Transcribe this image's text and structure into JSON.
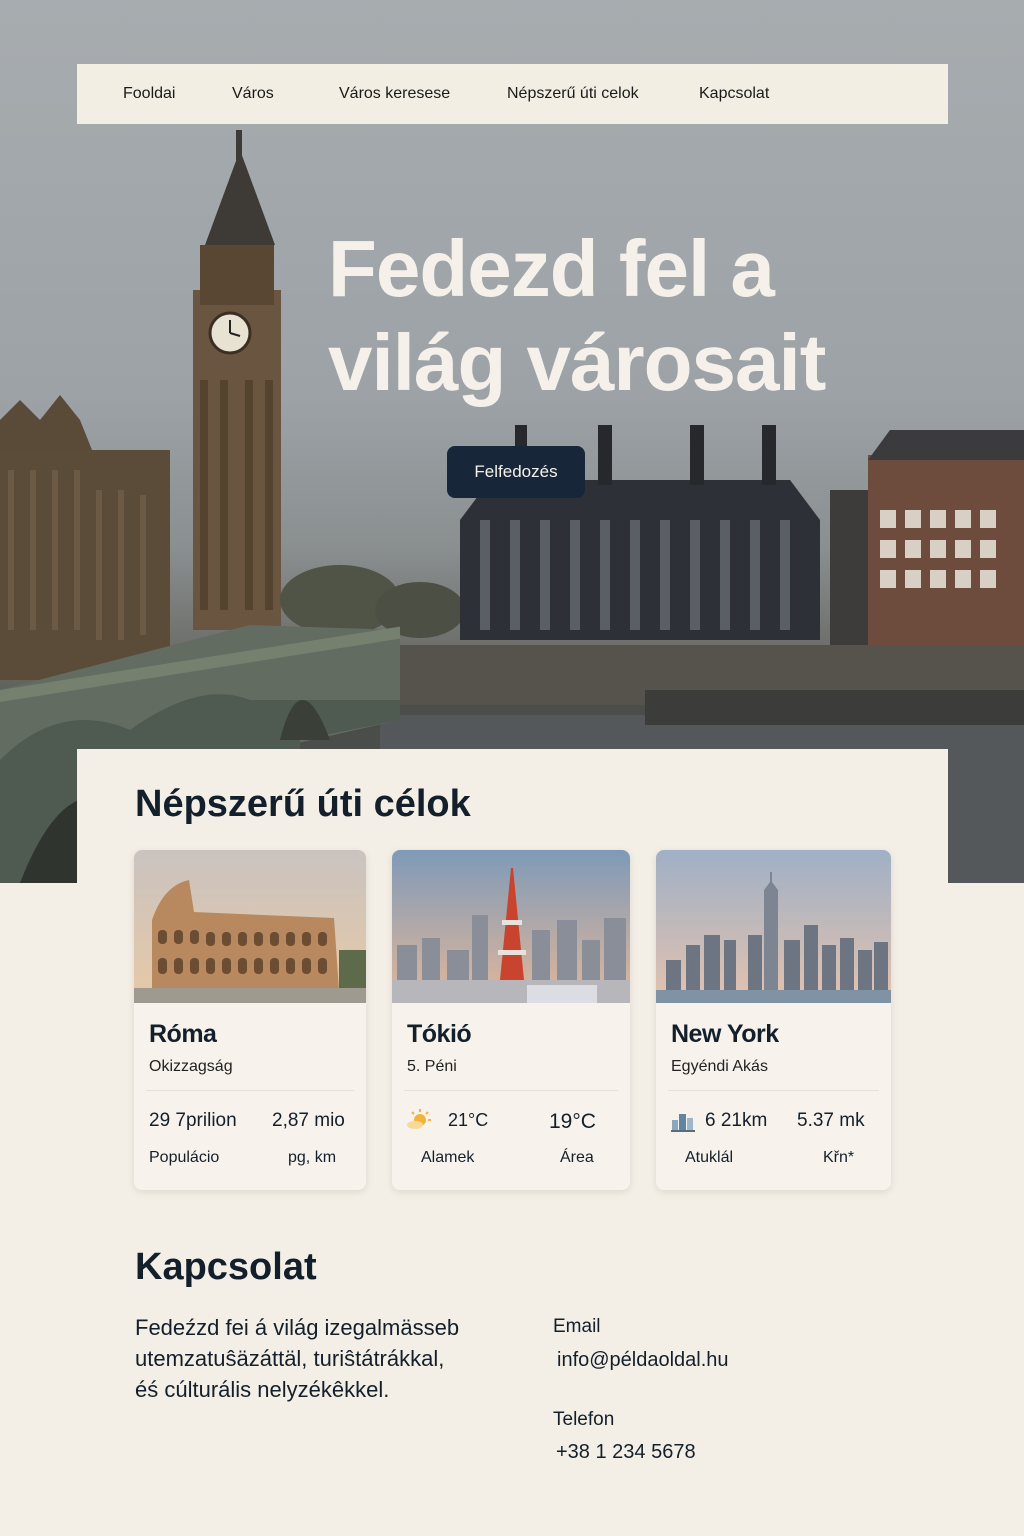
{
  "nav": {
    "items": [
      "Fooldai",
      "Város",
      "Város keresese",
      "Népszerű úti celok",
      "Kapcsolat"
    ]
  },
  "hero": {
    "title_line1": "Fedezd fel a",
    "title_line2": "világ városait",
    "button_label": "Felfedozés"
  },
  "popular": {
    "title": "Népszerű úti célok",
    "cards": [
      {
        "name": "Róma",
        "subtitle": "Okizzagság",
        "stat1": "29 7prilion",
        "stat2": "2,87 mio",
        "label1": "Populácio",
        "label2": "pg, km",
        "icon": "none"
      },
      {
        "name": "Tókió",
        "subtitle": "5. Péni",
        "stat1": "21°C",
        "stat2": "19°C",
        "label1": "Alamek",
        "label2": "Área",
        "icon": "sun-cloud-icon"
      },
      {
        "name": "New York",
        "subtitle": "Egyéndi Akás",
        "stat1": "6 21km",
        "stat2": "5.37 mk",
        "label1": "Atuklál",
        "label2": "Křn*",
        "icon": "buildings-icon"
      }
    ]
  },
  "contact": {
    "title": "Kapcsolat",
    "text_line1": "Fedeźzd fei á világ izegalmässeb",
    "text_line2": "utemzatuŝäzáttäl, turiŝtátrákkal,",
    "text_line3": "éś cúlturális nelyzékêkkel.",
    "email_label": "Email",
    "email_value": "info@példaoldal.hu",
    "phone_label": "Telefon",
    "phone_value": "+38 1 234 5678"
  },
  "colors": {
    "background": "#f4efe6",
    "button": "#18263a",
    "text": "#13202c"
  }
}
